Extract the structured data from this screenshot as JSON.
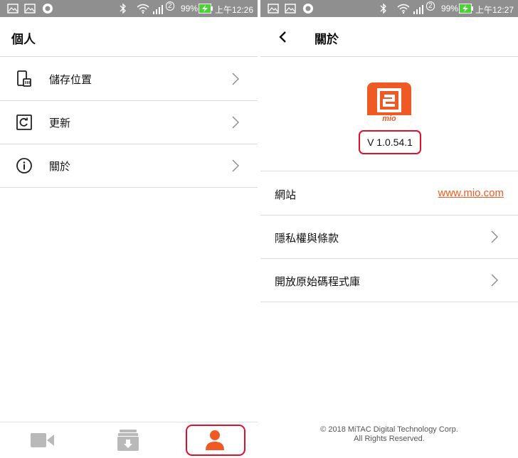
{
  "status_bar": {
    "battery": "99%",
    "sim_badge": "2",
    "left_time": "上午12:26",
    "right_time": "上午12:27"
  },
  "personal": {
    "title": "個人",
    "items": [
      {
        "label": "儲存位置",
        "icon": "phone-storage-icon"
      },
      {
        "label": "更新",
        "icon": "refresh-icon"
      },
      {
        "label": "關於",
        "icon": "info-icon"
      }
    ]
  },
  "about": {
    "title": "關於",
    "version": "V 1.0.54.1",
    "website_label": "網站",
    "website_link": "www.mio.com",
    "privacy_label": "隱私權與條款",
    "opensource_label": "開放原始碼程式庫",
    "copyright_line1": "© 2018 MiTAC Digital Technology Corp.",
    "copyright_line2": "All Rights Reserved.",
    "logo_text": "mio"
  },
  "bottom_nav": {
    "items": [
      "video-camera-icon",
      "download-archive-icon",
      "person-icon"
    ],
    "active_index": 2
  },
  "colors": {
    "accent": "#ef5a24",
    "highlight": "#e0102a",
    "status_bar": "#8f8f8f",
    "battery": "#4cd137"
  }
}
